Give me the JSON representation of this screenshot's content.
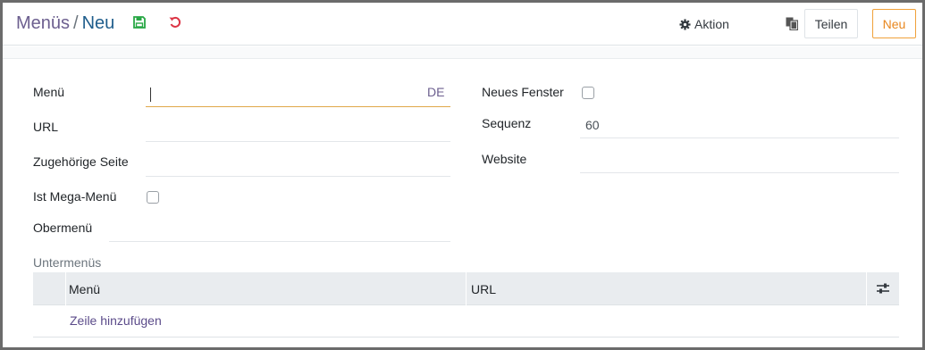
{
  "breadcrumb": {
    "parent": "Menüs",
    "separator": "/",
    "current": "Neu"
  },
  "toolbar": {
    "action_label": "Aktion",
    "share_label": "Teilen",
    "new_label": "Neu",
    "icons": [
      "save-icon",
      "discard-icon",
      "gear-icon",
      "copy-icon"
    ]
  },
  "form": {
    "menu_label": "Menü",
    "menu_value": "",
    "menu_lang": "DE",
    "url_label": "URL",
    "url_value": "",
    "page_label": "Zugehörige Seite",
    "page_value": "",
    "mega_menu_label": "Ist Mega-Menü",
    "mega_menu_checked": false,
    "parent_label": "Obermenü",
    "parent_value": "",
    "new_window_label": "Neues Fenster",
    "new_window_checked": false,
    "sequence_label": "Sequenz",
    "sequence_value": "60",
    "website_label": "Website",
    "website_value": ""
  },
  "submenus": {
    "title": "Untermenüs",
    "columns": [
      "Menü",
      "URL"
    ],
    "add_line_label": "Zeile hinzufügen",
    "rows": []
  },
  "colors": {
    "accent": "#e8871e",
    "breadcrumb_parent": "#6c5f8f",
    "breadcrumb_current": "#1f5d8c",
    "save_icon": "#28a745",
    "discard_icon": "#dc3545",
    "link": "#5b4b8a"
  }
}
